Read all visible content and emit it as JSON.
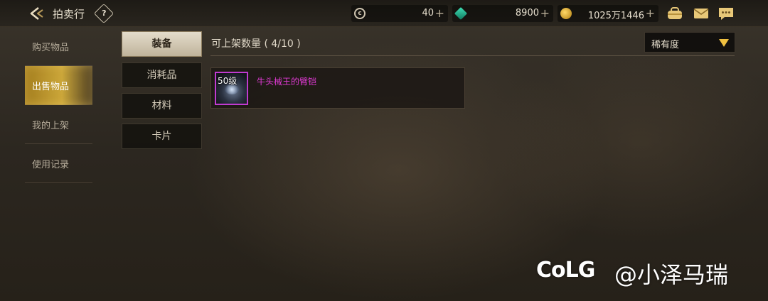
{
  "header": {
    "title": "拍卖行",
    "help_label": "?",
    "currencies": [
      {
        "icon": "coin-c-icon",
        "value": "40"
      },
      {
        "icon": "gem-icon",
        "value": "8900"
      },
      {
        "icon": "gold-coin-icon",
        "value": "1025万1446"
      }
    ],
    "plus_label": "+",
    "icons": [
      "back-arrow-icon",
      "help-icon",
      "bag-icon",
      "mail-icon",
      "chat-icon"
    ]
  },
  "sidebar": {
    "items": [
      {
        "label": "购买物品",
        "active": false
      },
      {
        "label": "出售物品",
        "active": true
      },
      {
        "label": "我的上架",
        "active": false
      },
      {
        "label": "使用记录",
        "active": false
      }
    ]
  },
  "categories": {
    "tabs": [
      {
        "label": "装备",
        "active": true
      },
      {
        "label": "消耗品",
        "active": false
      },
      {
        "label": "材料",
        "active": false
      },
      {
        "label": "卡片",
        "active": false
      }
    ]
  },
  "main": {
    "listing_count_label": "可上架数量 ( 4/10 )",
    "sort": {
      "selected": "稀有度"
    },
    "items": [
      {
        "level": "50级",
        "name": "牛头械王的臂铠",
        "name_color": "#e23ad6"
      }
    ]
  },
  "watermark": {
    "logo": "CoLG",
    "handle": "@小泽马瑞"
  },
  "colors": {
    "accent_gold": "#dcb43c",
    "rarity_purple": "#c03bd0"
  }
}
